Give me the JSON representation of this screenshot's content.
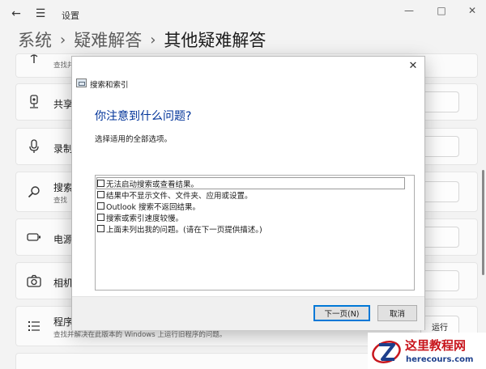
{
  "window": {
    "title": "设置",
    "breadcrumb": [
      "系统",
      "疑难解答",
      "其他疑难解答"
    ]
  },
  "cards": [
    {
      "title": "",
      "desc": "查找并",
      "icon": "antenna-icon"
    },
    {
      "title": "共享",
      "desc": "",
      "icon": "shared-folder-icon"
    },
    {
      "title": "录制",
      "desc": "",
      "icon": "microphone-icon"
    },
    {
      "title": "搜索",
      "desc": "查找",
      "icon": "search-icon"
    },
    {
      "title": "电源",
      "desc": "",
      "icon": "battery-icon"
    },
    {
      "title": "相机",
      "desc": "",
      "icon": "camera-icon"
    },
    {
      "title": "程序",
      "desc": "查找并解决在此版本的 Windows 上运行旧程序的问题。",
      "icon": "list-icon",
      "button": "运行"
    }
  ],
  "dialog": {
    "app_title": "搜索和索引",
    "heading": "你注意到什么问题?",
    "subheading": "选择适用的全部选项。",
    "options": [
      "无法启动搜索或查看结果。",
      "结果中不显示文件、文件夹、应用或设置。",
      "Outlook 搜索不返回结果。",
      "搜索或索引速度较慢。",
      "上面未列出我的问题。(请在下一页提供描述。)"
    ],
    "next_button": "下一页(N)",
    "cancel_button": "取消"
  },
  "watermark": {
    "name": "这里教程网",
    "url": "herecours.com"
  },
  "colors": {
    "heading": "#003399",
    "focus_border": "#0078d7",
    "watermark_red": "#c8161d",
    "watermark_blue": "#1d3f8c"
  }
}
